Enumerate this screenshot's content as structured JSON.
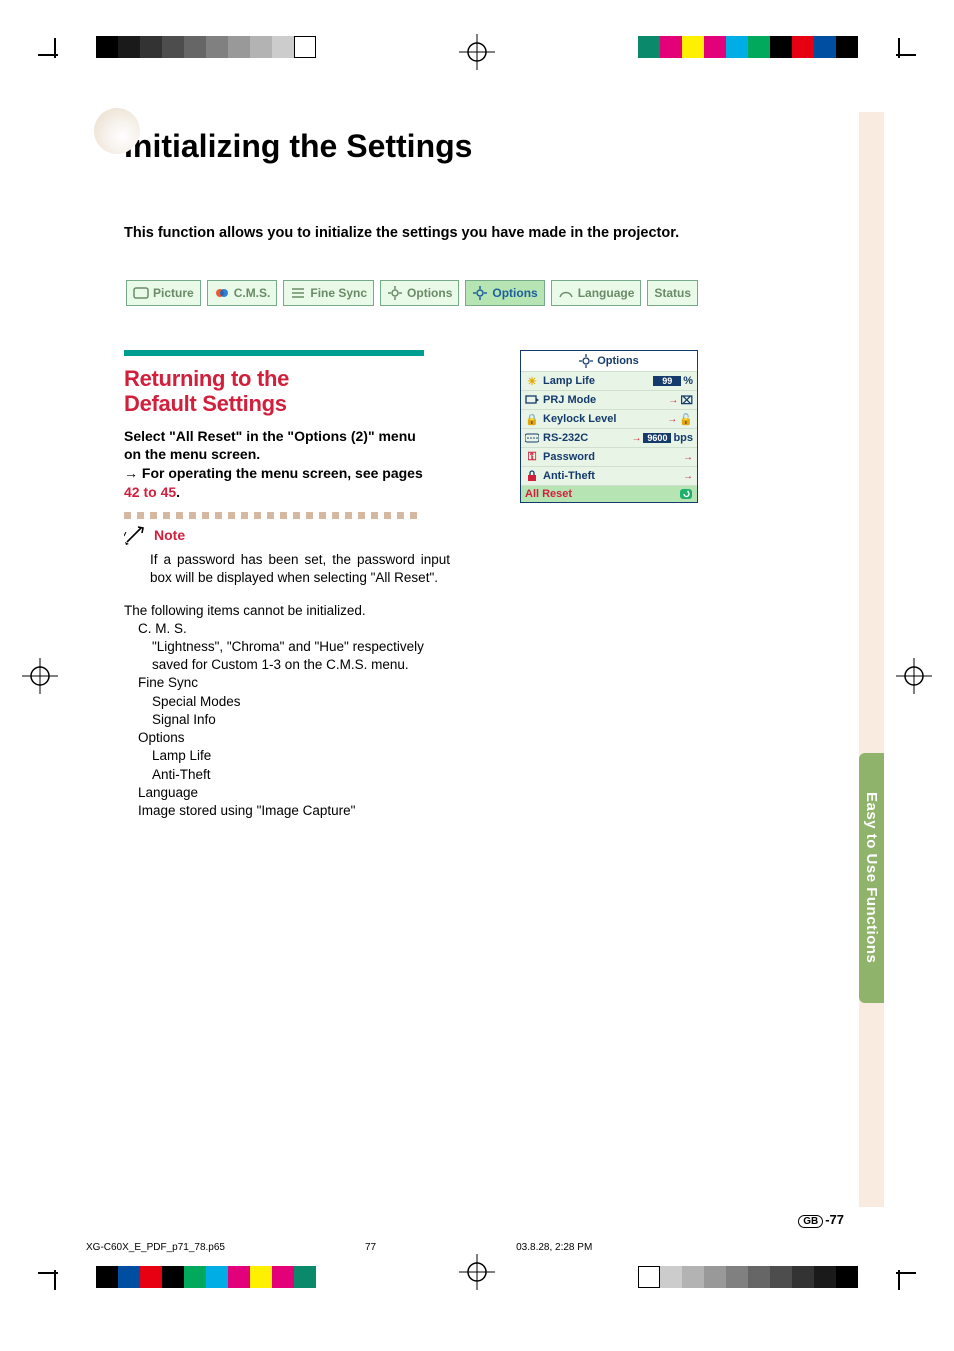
{
  "page": {
    "title": "Initializing the Settings",
    "intro": "This function allows you to initialize the settings you have made in the projector.",
    "section_tab": "Easy to Use Functions",
    "page_number_prefix": "GB",
    "page_number": "-77"
  },
  "menu_tabs": [
    {
      "label": "Picture",
      "icon": "picture-icon",
      "selected": false
    },
    {
      "label": "C.M.S.",
      "icon": "cms-icon",
      "selected": false
    },
    {
      "label": "Fine Sync",
      "icon": "finesync-icon",
      "selected": false
    },
    {
      "label": "Options",
      "icon": "options-icon",
      "selected": false
    },
    {
      "label": "Options",
      "icon": "options-icon",
      "selected": true
    },
    {
      "label": "Language",
      "icon": "language-icon",
      "selected": false
    },
    {
      "label": "Status",
      "icon": "status-icon",
      "selected": false
    }
  ],
  "section": {
    "heading_l1": "Returning to the",
    "heading_l2": "Default Settings",
    "lead_1": "Select \"All Reset\" in the \"Options (2)\" menu on the menu screen.",
    "lead_2_prefix": "→ ",
    "lead_2": "For operating the menu screen, see pages ",
    "lead_2_link": "42 to 45",
    "lead_2_suffix": "."
  },
  "note": {
    "label": "Note",
    "body": "If a password has been set, the password input box will be displayed when selecting \"All Reset\".",
    "list_intro": "The following items cannot be initialized.",
    "items": {
      "cms": "C. M. S.",
      "cms_sub": "\"Lightness\", \"Chroma\" and \"Hue\" respectively saved for Custom 1-3 on the C.M.S. menu.",
      "finesync": "Fine Sync",
      "fs_a": "Special Modes",
      "fs_b": "Signal Info",
      "options": "Options",
      "op_a": "Lamp Life",
      "op_b": "Anti-Theft",
      "language": "Language",
      "image": "Image stored using \"Image Capture\""
    }
  },
  "osd": {
    "title": "Options",
    "rows": [
      {
        "icon": "lamp-icon",
        "label": "Lamp Life",
        "value": "99",
        "unit": "%",
        "arrow": false,
        "bar": true
      },
      {
        "icon": "prj-icon",
        "label": "PRJ Mode",
        "value": "",
        "unit": "tv",
        "arrow": true,
        "bar": false
      },
      {
        "icon": "lock-icon",
        "label": "Keylock Level",
        "value": "",
        "unit": "lock",
        "arrow": true,
        "bar": false
      },
      {
        "icon": "serial-icon",
        "label": "RS-232C",
        "value": "9600",
        "unit": "bps",
        "arrow": true,
        "bar": true
      },
      {
        "icon": "key-icon",
        "label": "Password",
        "value": "",
        "unit": "",
        "arrow": true,
        "bar": false
      },
      {
        "icon": "theft-icon",
        "label": "Anti-Theft",
        "value": "",
        "unit": "",
        "arrow": true,
        "bar": false
      },
      {
        "icon": "reset-icon",
        "label": "All Reset",
        "value": "",
        "unit": "reset",
        "arrow": false,
        "bar": false,
        "selected": true
      }
    ]
  },
  "footer": {
    "file": "XG-C60X_E_PDF_p71_78.p65",
    "page": "77",
    "time": "03.8.28, 2:28 PM"
  }
}
